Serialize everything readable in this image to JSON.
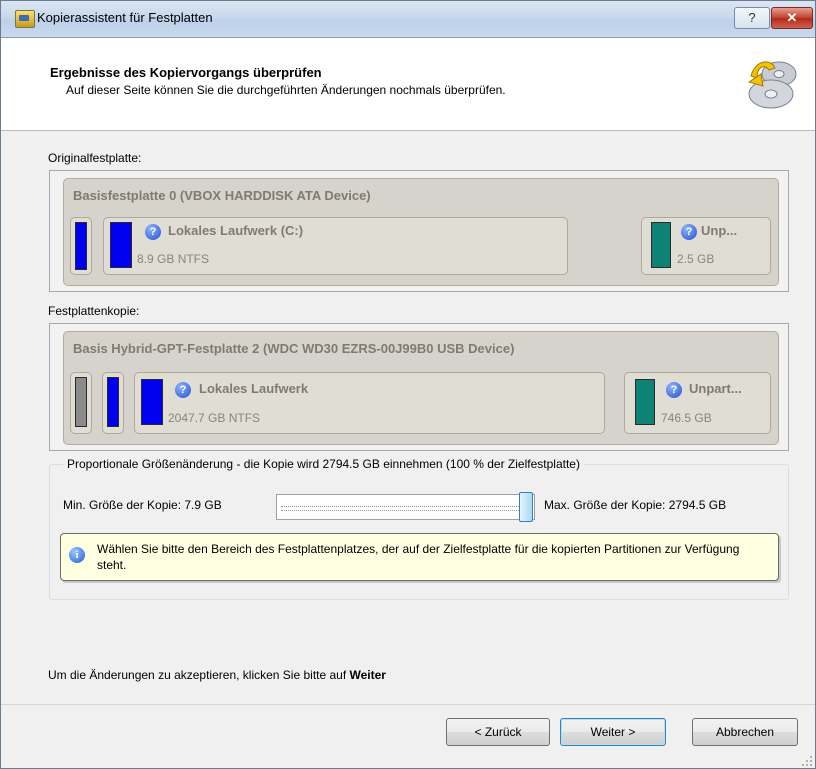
{
  "window": {
    "title": "Kopierassistent für Festplatten",
    "help_label": "?",
    "close_label": "✕"
  },
  "header": {
    "title": "Ergebnisse des Kopiervorgangs überprüfen",
    "subtitle": "Auf dieser Seite können Sie die durchgeführten Änderungen nochmals überprüfen."
  },
  "original": {
    "label": "Originalfestplatte:",
    "disk_title": "Basisfestplatte 0 (VBOX HARDDISK ATA Device)",
    "partitions": [
      {
        "name": "Lokales Laufwerk (C:)",
        "size": "8.9 GB NTFS",
        "color": "#0000ee"
      },
      {
        "name": "Unp...",
        "size": "2.5 GB",
        "color": "#0f8276"
      }
    ]
  },
  "copy": {
    "label": "Festplattenkopie:",
    "disk_title": "Basis Hybrid-GPT-Festplatte 2 (WDC WD30 EZRS-00J99B0 USB Device)",
    "partitions": [
      {
        "name": "Lokales Laufwerk",
        "size": "2047.7 GB NTFS",
        "color": "#0000ee"
      },
      {
        "name": "Unpart...",
        "size": "746.5 GB",
        "color": "#0f8276"
      }
    ]
  },
  "resize": {
    "group_label": "Proportionale Größenänderung - die Kopie wird 2794.5 GB einnehmen (100 % der Zielfestplatte)",
    "min_label": "Min. Größe der Kopie:  7.9 GB",
    "max_label": "Max. Größe der Kopie:   2794.5 GB",
    "slider_value_percent": 100,
    "info_text": "Wählen Sie bitte den Bereich des Festplattenplatzes, der auf der Zielfestplatte für die kopierten Partitionen zur Verfügung steht."
  },
  "footer": {
    "accept_text": "Um die Änderungen zu akzeptieren, klicken Sie bitte auf ",
    "accept_bold": "Weiter",
    "back_label": "< Zurück",
    "next_label": "Weiter >",
    "cancel_label": "Abbrechen"
  }
}
